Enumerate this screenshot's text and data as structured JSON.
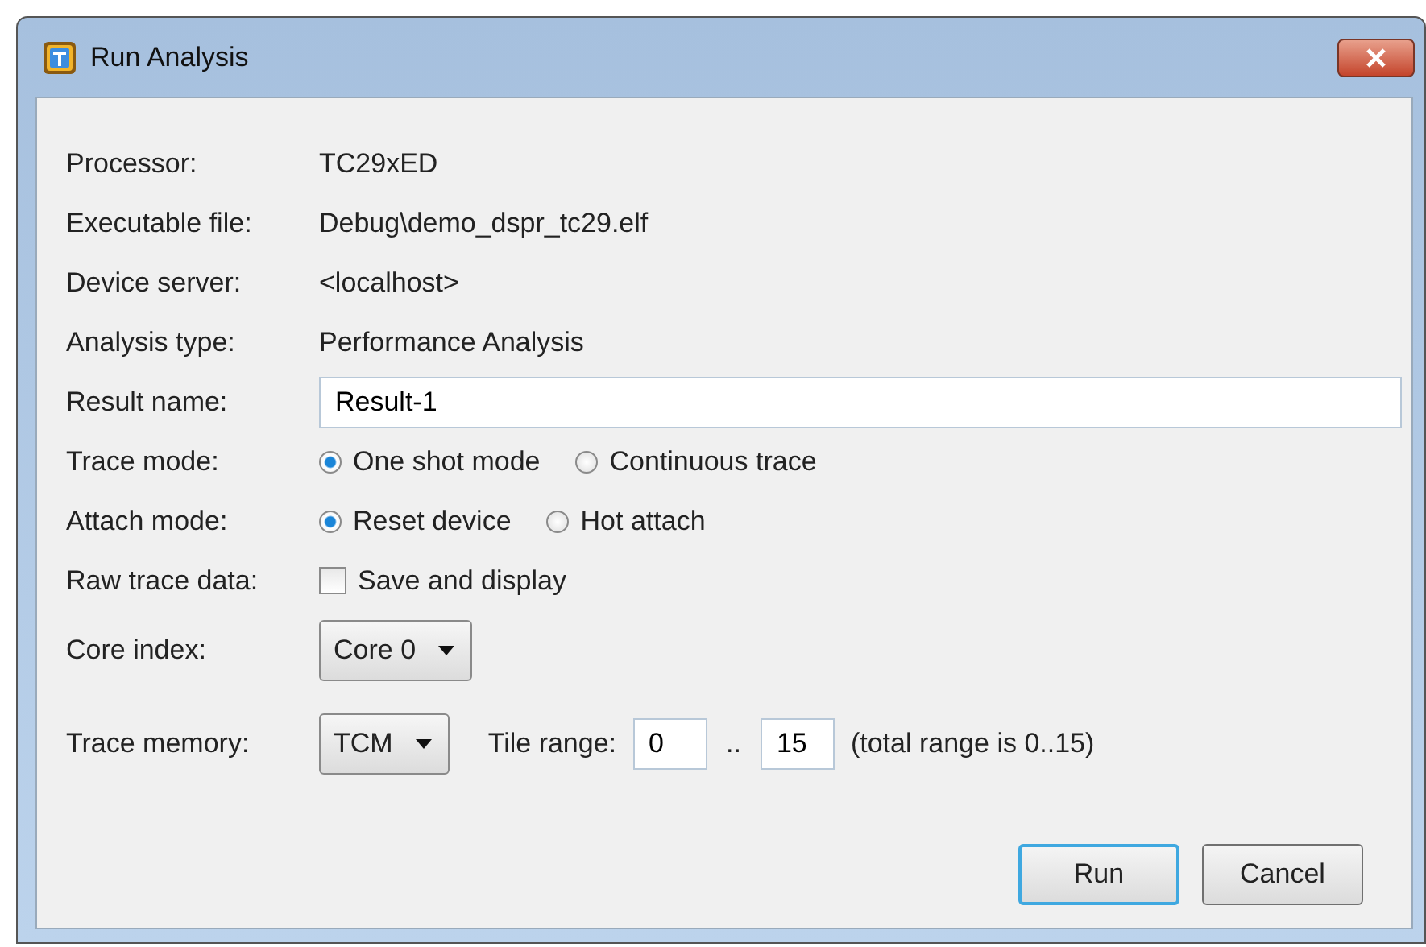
{
  "window": {
    "title": "Run Analysis"
  },
  "fields": [
    {
      "kind": "info",
      "label": "Processor:",
      "value": "TC29xED"
    },
    {
      "kind": "info",
      "label": "Executable file:",
      "value": "Debug\\demo_dspr_tc29.elf"
    },
    {
      "kind": "info",
      "label": "Device server:",
      "value": "<localhost>"
    },
    {
      "kind": "info",
      "label": "Analysis type:",
      "value": "Performance Analysis"
    },
    {
      "kind": "text",
      "label": "Result name:",
      "value": "Result-1"
    },
    {
      "kind": "radio",
      "label": "Trace mode:",
      "options": [
        {
          "label": "One shot mode",
          "selected": true
        },
        {
          "label": "Continuous trace",
          "selected": false
        }
      ]
    },
    {
      "kind": "radio",
      "label": "Attach mode:",
      "options": [
        {
          "label": "Reset device",
          "selected": true
        },
        {
          "label": "Hot attach",
          "selected": false
        }
      ]
    },
    {
      "kind": "checkbox",
      "label": "Raw trace data:",
      "option": "Save and display",
      "checked": false
    },
    {
      "kind": "dropdown",
      "label": "Core index:",
      "value": "Core 0"
    },
    {
      "kind": "memory",
      "label": "Trace memory:",
      "value": "TCM",
      "range_label": "Tile range:",
      "from": "0",
      "separator": "..",
      "to": "15",
      "note": "(total range is 0..15)"
    }
  ],
  "buttons": [
    {
      "label": "Run",
      "default": true
    },
    {
      "label": "Cancel",
      "default": false
    }
  ]
}
